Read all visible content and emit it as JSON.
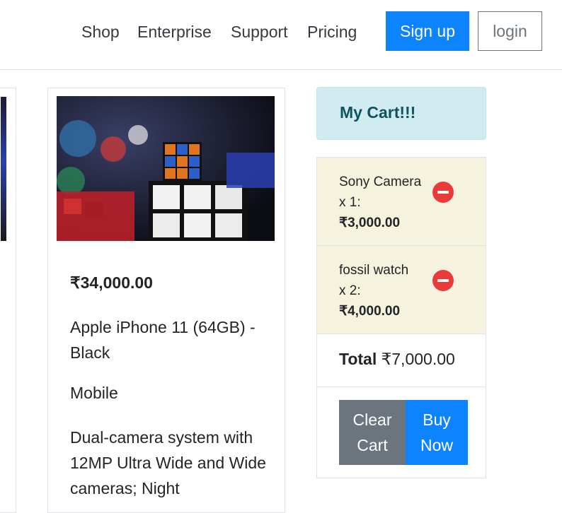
{
  "nav": {
    "links": [
      "Shop",
      "Enterprise",
      "Support",
      "Pricing"
    ],
    "signup_label": "Sign up",
    "login_label": "login"
  },
  "product": {
    "price": "₹34,000.00",
    "name": "Apple iPhone 11 (64GB) - Black",
    "category": "Mobile",
    "description": "Dual-camera system with 12MP Ultra Wide and Wide cameras; Night"
  },
  "cart": {
    "title": "My Cart!!!",
    "items": [
      {
        "name": "Sony Camera",
        "qty": "x 1:",
        "price": "₹3,000.00"
      },
      {
        "name": "fossil watch",
        "qty": "x 2:",
        "price": "₹4,000.00"
      }
    ],
    "total_label": "Total",
    "total_value": "₹7,000.00",
    "clear_label": "Clear Cart",
    "buy_label": "Buy Now"
  },
  "colors": {
    "primary": "#0d83fd",
    "secondary": "#6c757d",
    "remove": "#ea3a3a",
    "cart_header_bg": "#d1ecf1",
    "cart_item_bg": "#f5f3de"
  },
  "icons": {
    "remove": "minus-circle-icon"
  }
}
